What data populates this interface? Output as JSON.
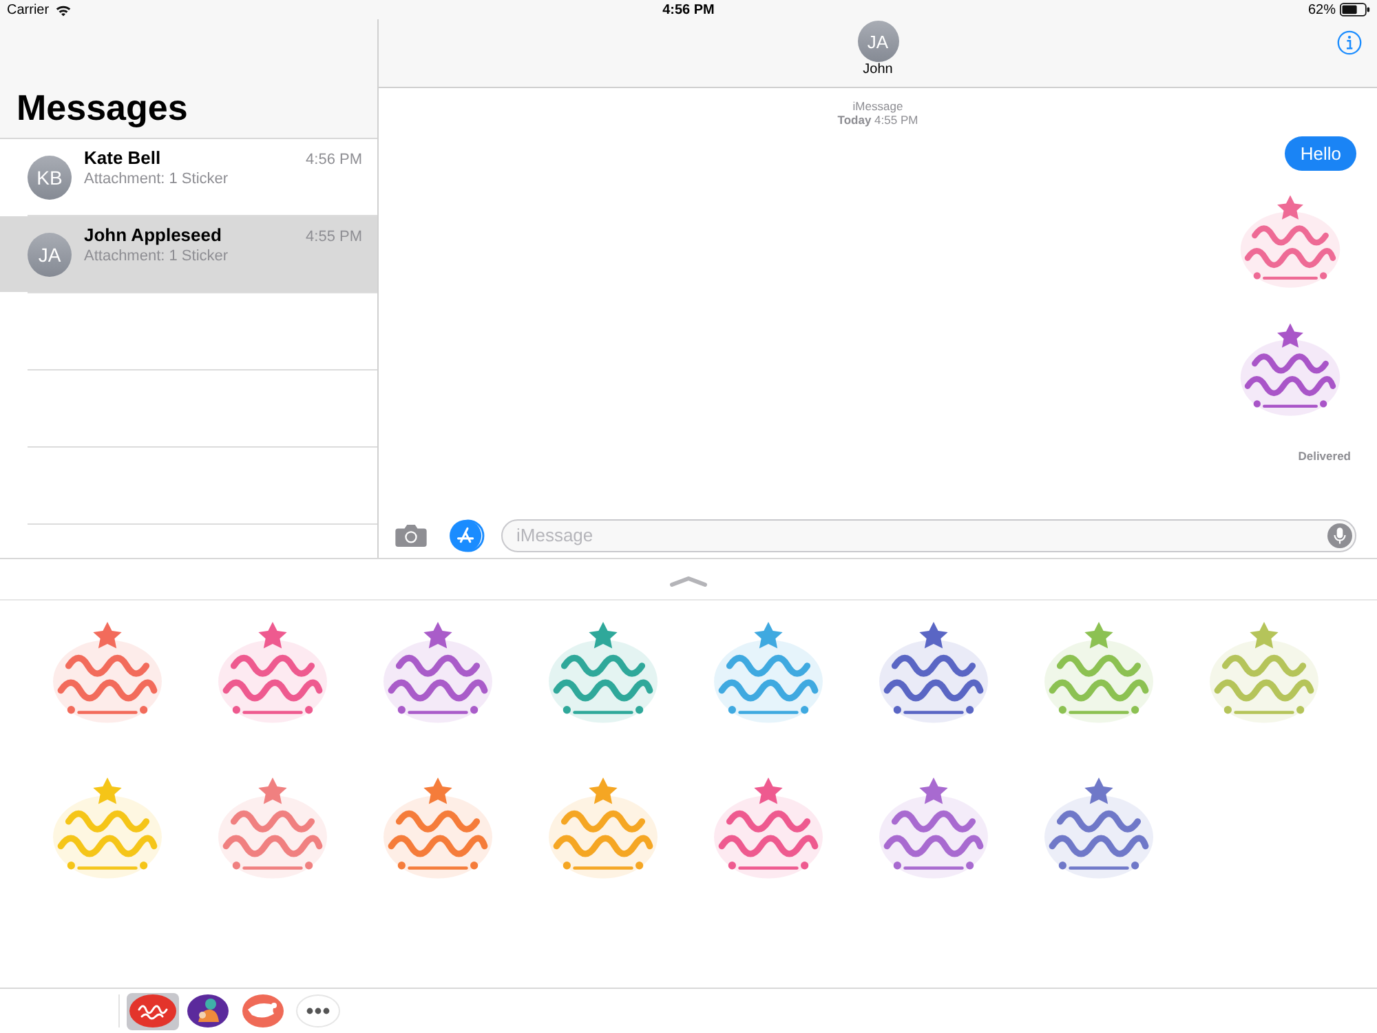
{
  "status_bar": {
    "carrier": "Carrier",
    "time": "4:56 PM",
    "battery": "62%"
  },
  "sidebar": {
    "title": "Messages",
    "conversations": [
      {
        "initials": "KB",
        "name": "Kate Bell",
        "preview": "Attachment: 1 Sticker",
        "time": "4:56 PM",
        "selected": false
      },
      {
        "initials": "JA",
        "name": "John Appleseed",
        "preview": "Attachment: 1 Sticker",
        "time": "4:55 PM",
        "selected": true
      }
    ]
  },
  "chat": {
    "contact": {
      "initials": "JA",
      "name": "John"
    },
    "service": "iMessage",
    "timestamp": "**Today** 4:55 PM",
    "messages": [
      {
        "kind": "text",
        "text": "Hello"
      },
      {
        "kind": "sticker",
        "color": "#ee6a95"
      },
      {
        "kind": "sticker",
        "color": "#a955c8"
      }
    ],
    "receipt": "Delivered",
    "composer": {
      "placeholder": "iMessage"
    }
  },
  "sticker_drawer": {
    "stickers": [
      {
        "color": "#f26b5b"
      },
      {
        "color": "#ee5a8f"
      },
      {
        "color": "#a95cc9"
      },
      {
        "color": "#2fa89a"
      },
      {
        "color": "#3fa9e0"
      },
      {
        "color": "#5a66c4"
      },
      {
        "color": "#8cc152"
      },
      {
        "color": "#b5c45a"
      },
      {
        "color": "#f5c518"
      },
      {
        "color": "#f08080"
      },
      {
        "color": "#f57c3a"
      },
      {
        "color": "#f5a623"
      },
      {
        "color": "#ee5a8f"
      },
      {
        "color": "#a86ad0"
      },
      {
        "color": "#6f78c8"
      }
    ]
  },
  "app_strip": [
    {
      "kind": "badge",
      "selected": true
    },
    {
      "kind": "figure",
      "selected": false
    },
    {
      "kind": "hat",
      "selected": false
    },
    {
      "kind": "more",
      "selected": false
    }
  ]
}
